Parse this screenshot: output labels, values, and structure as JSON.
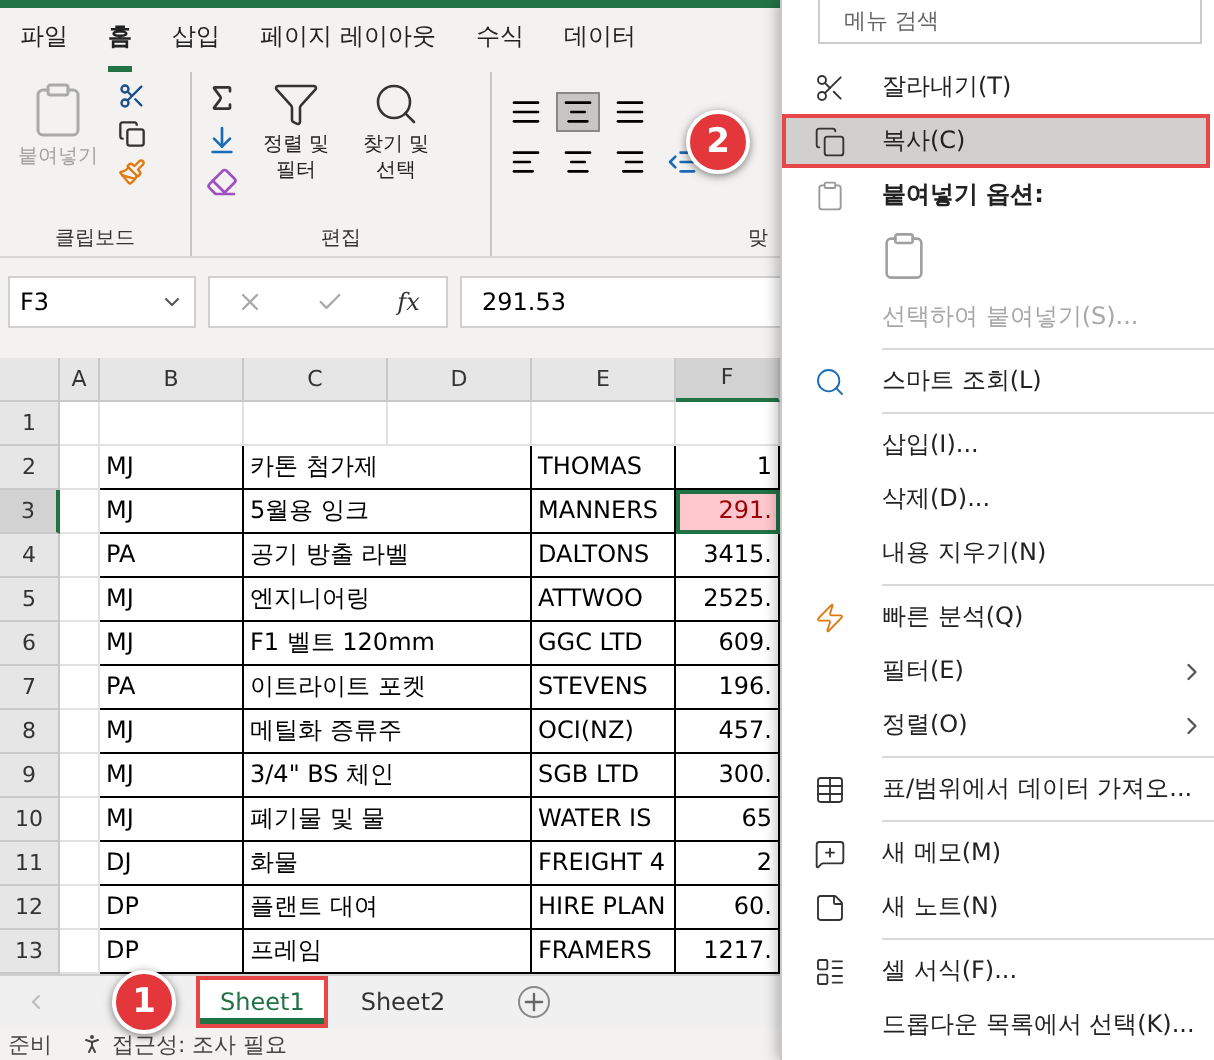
{
  "ribbon": {
    "tabs": [
      {
        "label": "파일",
        "selected": false
      },
      {
        "label": "홈",
        "selected": true
      },
      {
        "label": "삽입",
        "selected": false
      },
      {
        "label": "페이지 레이아웃",
        "selected": false
      },
      {
        "label": "수식",
        "selected": false
      },
      {
        "label": "데이터",
        "selected": false
      }
    ],
    "groups": [
      {
        "kind": "clipboard",
        "label": "클립보드",
        "paste": {
          "label": "붙여넣기",
          "disabled": true
        }
      },
      {
        "kind": "editing",
        "label": "편집",
        "sort": "정렬 및 필터",
        "find": "찾기 및 선택"
      },
      {
        "kind": "alignment",
        "label": "맞"
      }
    ]
  },
  "formula_bar": {
    "name_box": "F3",
    "function_symbol": "fx",
    "value": "291.53"
  },
  "sheet": {
    "columns": [
      {
        "label": "A",
        "selected": false
      },
      {
        "label": "B",
        "selected": false
      },
      {
        "label": "C",
        "selected": false
      },
      {
        "label": "D",
        "selected": false
      },
      {
        "label": "E",
        "selected": false
      },
      {
        "label": "F",
        "selected": true
      }
    ],
    "rows": [
      {
        "number": "1",
        "selected": false
      },
      {
        "number": "2",
        "selected": false,
        "cells": [
          "MJ",
          "카톤 첨가제",
          "THOMAS",
          "1"
        ]
      },
      {
        "number": "3",
        "selected": true,
        "cells": [
          "MJ",
          "5월용 잉크",
          "MANNERS",
          "291."
        ]
      },
      {
        "number": "4",
        "selected": false,
        "cells": [
          "PA",
          "공기 방출 라벨",
          "DALTONS",
          "3415."
        ]
      },
      {
        "number": "5",
        "selected": false,
        "cells": [
          "MJ",
          "엔지니어링",
          "ATTWOO",
          "2525."
        ]
      },
      {
        "number": "6",
        "selected": false,
        "cells": [
          "MJ",
          "F1 벨트 120mm",
          "GGC LTD",
          "609."
        ]
      },
      {
        "number": "7",
        "selected": false,
        "cells": [
          "PA",
          "이트라이트 포켓",
          "STEVENS",
          "196."
        ]
      },
      {
        "number": "8",
        "selected": false,
        "cells": [
          "MJ",
          "메틸화 증류주",
          "OCI(NZ)",
          "457."
        ]
      },
      {
        "number": "9",
        "selected": false,
        "cells": [
          "MJ",
          "3/4\" BS 체인",
          "SGB LTD",
          "300."
        ]
      },
      {
        "number": "10",
        "selected": false,
        "cells": [
          "MJ",
          "폐기물 및 물",
          "WATER IS",
          "65"
        ]
      },
      {
        "number": "11",
        "selected": false,
        "cells": [
          "DJ",
          "화물",
          "FREIGHT 4",
          "2"
        ]
      },
      {
        "number": "12",
        "selected": false,
        "cells": [
          "DP",
          "플랜트 대여",
          "HIRE PLAN",
          "60."
        ]
      },
      {
        "number": "13",
        "selected": false,
        "cells": [
          "DP",
          "프레임",
          "FRAMERS",
          "1217."
        ]
      }
    ]
  },
  "sheet_tabs": [
    {
      "label": "Sheet1",
      "selected": true,
      "callout": "1"
    },
    {
      "label": "Sheet2",
      "selected": false
    }
  ],
  "status_bar": {
    "mode": "준비",
    "accessibility": "접근성: 조사 필요"
  },
  "context_menu": {
    "search_placeholder": "메뉴 검색",
    "items": [
      {
        "kind": "command",
        "label": "잘라내기(T)",
        "selected": false,
        "disabled": false,
        "submenu": false
      },
      {
        "kind": "command",
        "label": "복사(C)",
        "selected": true,
        "disabled": false,
        "submenu": false,
        "highlighted": true,
        "callout": "2"
      },
      {
        "kind": "heading",
        "label": "붙여넣기 옵션:"
      },
      {
        "kind": "paste_options"
      },
      {
        "kind": "command",
        "label": "선택하여 붙여넣기(S)...",
        "selected": false,
        "disabled": true,
        "submenu": false
      },
      {
        "kind": "separator"
      },
      {
        "kind": "command",
        "label": "스마트 조회(L)",
        "selected": false,
        "disabled": false,
        "submenu": false
      },
      {
        "kind": "separator"
      },
      {
        "kind": "command",
        "label": "삽입(I)...",
        "selected": false,
        "disabled": false,
        "submenu": false
      },
      {
        "kind": "command",
        "label": "삭제(D)...",
        "selected": false,
        "disabled": false,
        "submenu": false
      },
      {
        "kind": "command",
        "label": "내용 지우기(N)",
        "selected": false,
        "disabled": false,
        "submenu": false
      },
      {
        "kind": "separator"
      },
      {
        "kind": "command",
        "label": "빠른 분석(Q)",
        "selected": false,
        "disabled": false,
        "submenu": false
      },
      {
        "kind": "command",
        "label": "필터(E)",
        "selected": false,
        "disabled": false,
        "submenu": true
      },
      {
        "kind": "command",
        "label": "정렬(O)",
        "selected": false,
        "disabled": false,
        "submenu": true
      },
      {
        "kind": "separator"
      },
      {
        "kind": "command",
        "label": "표/범위에서 데이터 가져오...",
        "selected": false,
        "disabled": false,
        "submenu": false
      },
      {
        "kind": "separator"
      },
      {
        "kind": "command",
        "label": "새 메모(M)",
        "selected": false,
        "disabled": false,
        "submenu": false
      },
      {
        "kind": "command",
        "label": "새 노트(N)",
        "selected": false,
        "disabled": false,
        "submenu": false
      },
      {
        "kind": "separator"
      },
      {
        "kind": "command",
        "label": "셀 서식(F)...",
        "selected": false,
        "disabled": false,
        "submenu": false
      },
      {
        "kind": "command",
        "label": "드롭다운 목록에서 선택(K)...",
        "selected": false,
        "disabled": false,
        "submenu": false
      }
    ]
  }
}
